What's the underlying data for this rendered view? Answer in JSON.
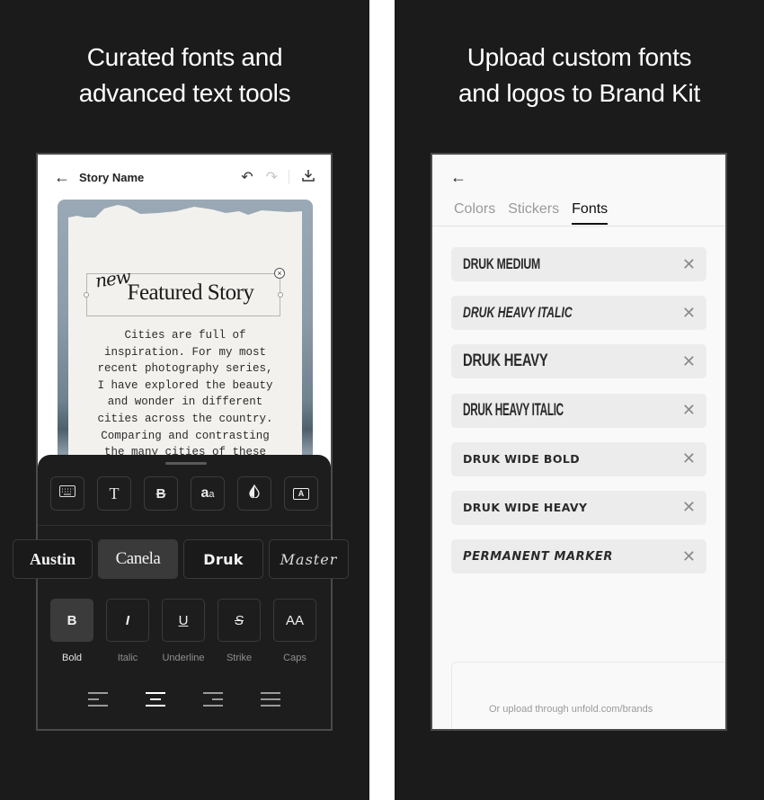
{
  "left_panel": {
    "headline": [
      "Curated fonts and",
      "advanced text tools"
    ],
    "editor": {
      "back_icon": "arrow-left-icon",
      "story_name": "Story Name",
      "undo_icon": "undo-icon",
      "redo_icon": "redo-icon",
      "download_icon": "download-icon",
      "story": {
        "accent_word": "new",
        "title": "Featured Story",
        "body_lines": [
          "Cities are full of",
          "inspiration. For my most",
          "recent photography series,",
          "I have explored the beauty",
          "and wonder in different",
          "cities across the country.",
          "Comparing and contrasting",
          "the many cities of these"
        ]
      },
      "toolbar_icons": [
        "keyboard-icon",
        "text-icon",
        "text-style-icon",
        "font-size-icon",
        "color-drop-icon",
        "text-background-icon"
      ],
      "fonts": [
        {
          "label": "Austin",
          "active": false
        },
        {
          "label": "Canela",
          "active": true
        },
        {
          "label": "Druk",
          "active": false
        },
        {
          "label": "Master",
          "active": false
        }
      ],
      "styles": [
        {
          "glyph": "B",
          "label": "Bold",
          "active": true
        },
        {
          "glyph": "I",
          "label": "Italic",
          "active": false
        },
        {
          "glyph": "U",
          "label": "Underline",
          "active": false
        },
        {
          "glyph": "S",
          "label": "Strike",
          "active": false
        },
        {
          "glyph": "AA",
          "label": "Caps",
          "active": false
        }
      ],
      "alignments": [
        {
          "name": "align-left",
          "active": false
        },
        {
          "name": "align-center",
          "active": true
        },
        {
          "name": "align-right",
          "active": false
        },
        {
          "name": "align-justify",
          "active": false
        }
      ]
    }
  },
  "right_panel": {
    "headline": [
      "Upload custom fonts",
      "and logos to Brand Kit"
    ],
    "brand_kit": {
      "back_icon": "arrow-left-icon",
      "tabs": [
        {
          "label": "Colors",
          "active": false
        },
        {
          "label": "Stickers",
          "active": false
        },
        {
          "label": "Fonts",
          "active": true
        }
      ],
      "fonts": [
        "DRUK MEDIUM",
        "DRUK HEAVY ITALIC",
        "DRUK HEAVY",
        "DRUK HEAVY ITALIC",
        "DRUK WIDE BOLD",
        "DRUK WIDE HEAVY",
        "PERMANENT MARKER"
      ],
      "upload_hint": "Or upload through unfold.com/brands"
    }
  },
  "colors": {
    "background": "#1b1b1b",
    "gap": "#ffffff",
    "chip_active": "#3a3a3a",
    "font_row": "#ececec"
  }
}
